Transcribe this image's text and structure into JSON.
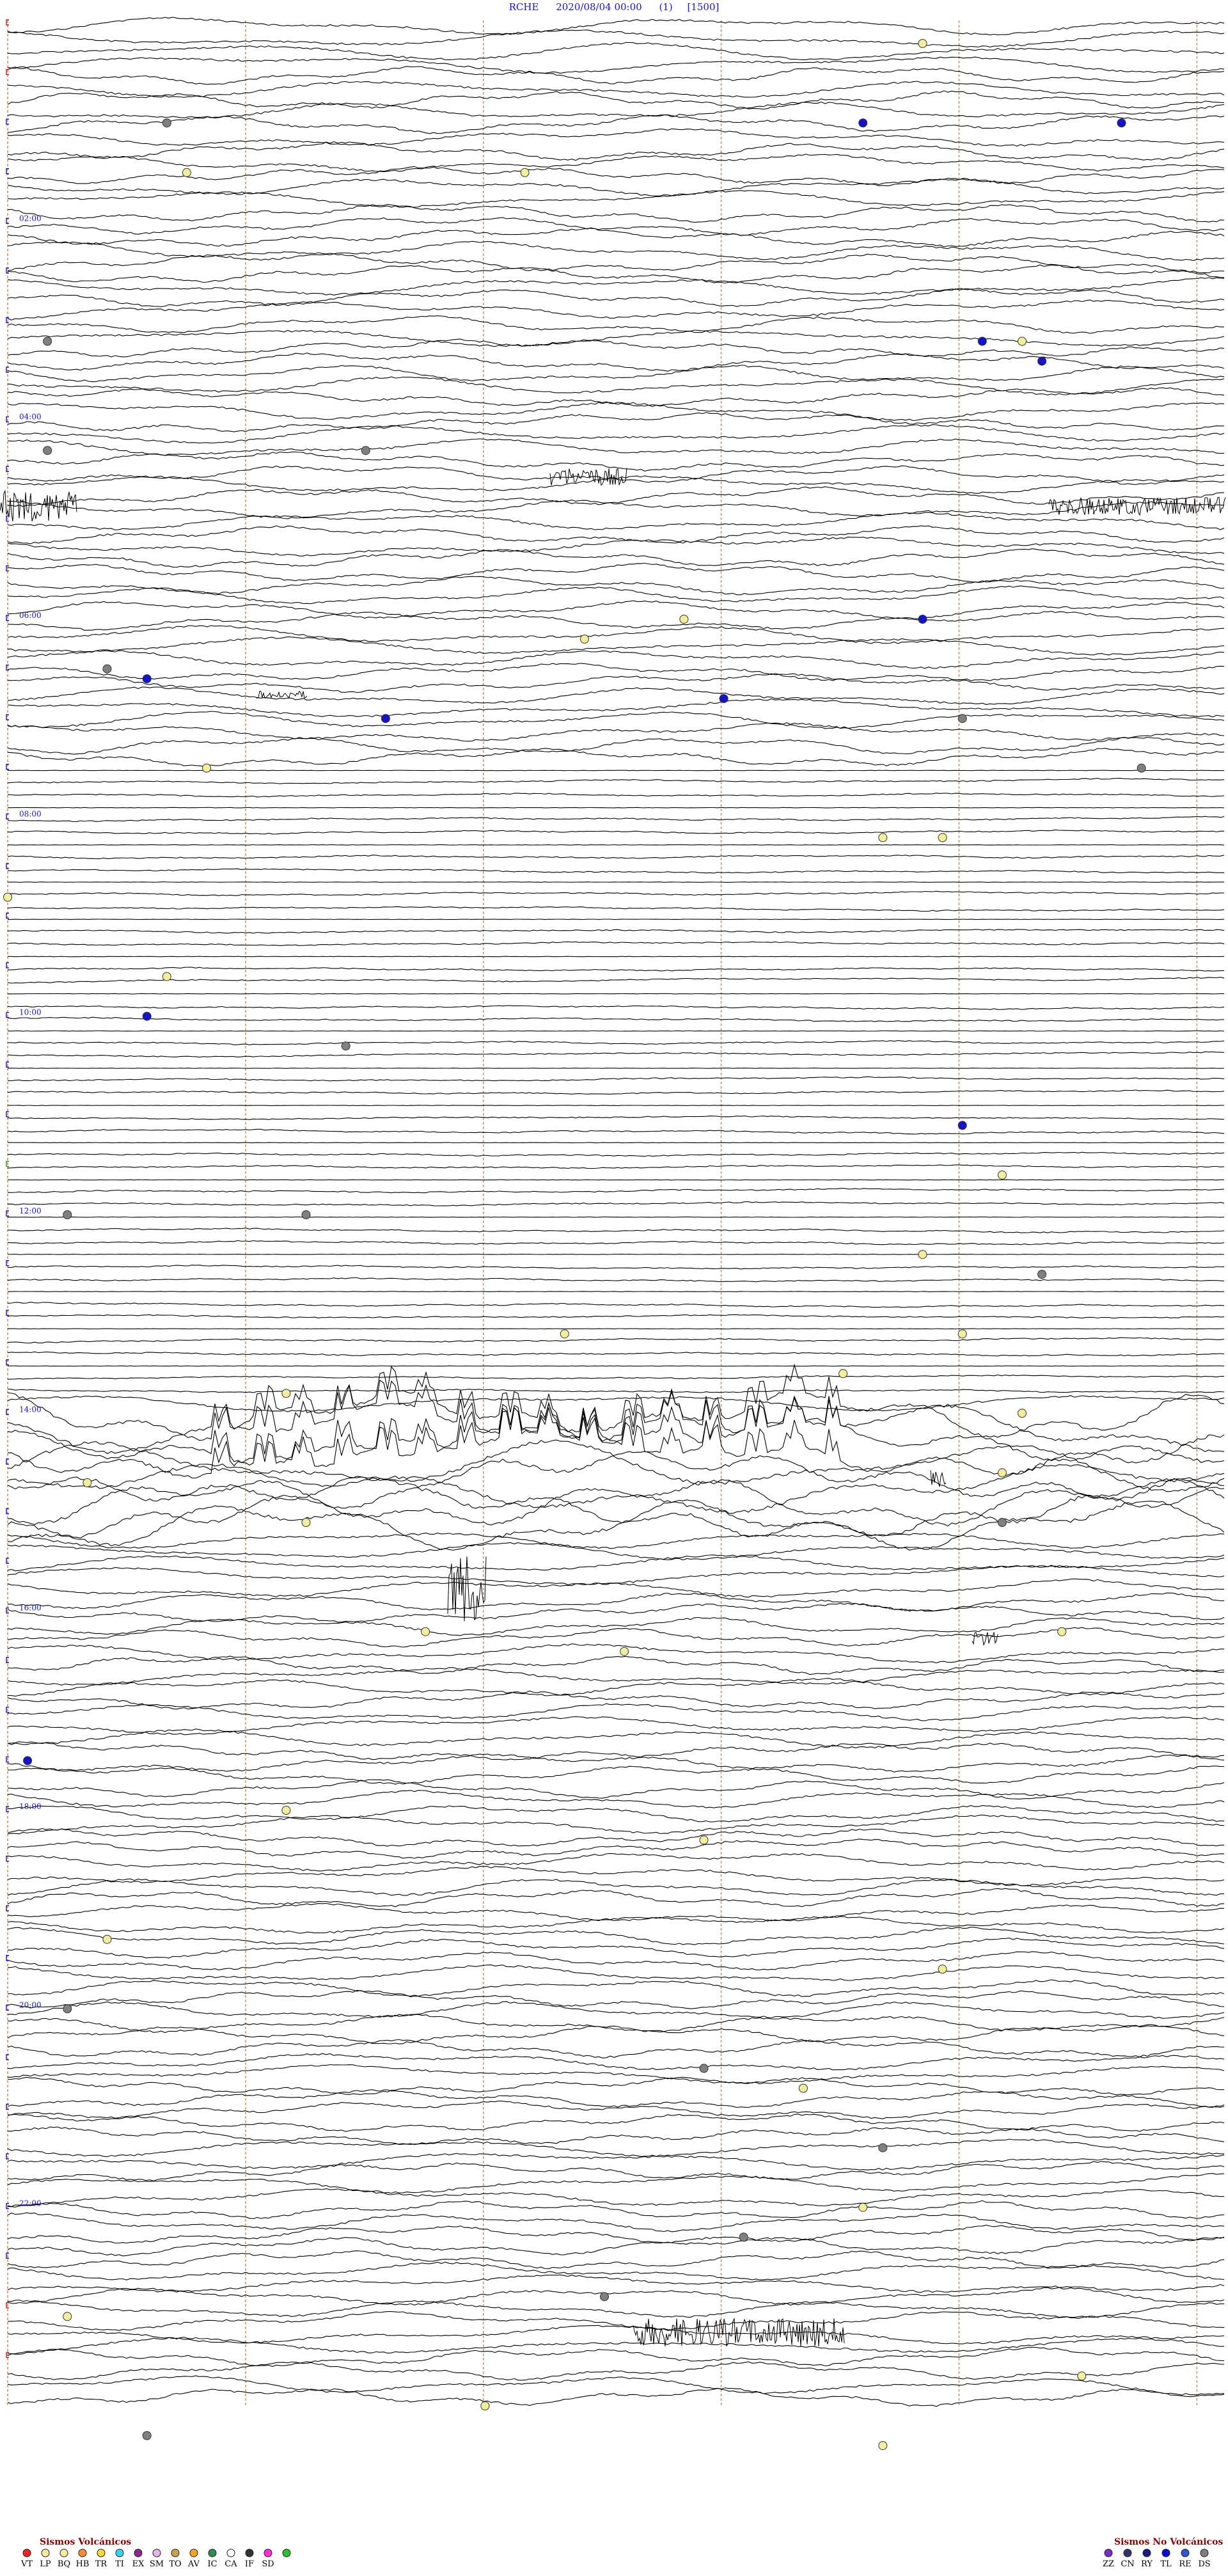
{
  "header": {
    "station": "RCHE",
    "datetime": "2020/08/04 00:00",
    "component": "(1)",
    "scale": "[1500]"
  },
  "chart_data": {
    "type": "line",
    "title": "RCHE    2020/08/04 00:00      (1)     [1500]",
    "description_hint": "helicorder seismogram, 24 hours",
    "time_labels": [
      "02:00",
      "04:00",
      "06:00",
      "08:00",
      "10:00",
      "12:00",
      "14:00",
      "16:00",
      "18:00",
      "20:00",
      "22:00"
    ],
    "hours": 24,
    "grid": true,
    "colors": {
      "trace": "#000000",
      "time_label": "#1414c8",
      "minute_guides": "#e07a3c",
      "row_marker_blue": "#1414c8",
      "row_marker_red": "#c81414",
      "row_marker_green": "#14a014"
    },
    "event_markers": [
      {
        "hour": 0.2,
        "minute": 46,
        "type": "LP"
      },
      {
        "hour": 1.0,
        "minute": 8,
        "type": "DS"
      },
      {
        "hour": 1.0,
        "minute": 56,
        "type": "RE"
      },
      {
        "hour": 1.0,
        "minute": 43,
        "type": "RE"
      },
      {
        "hour": 1.5,
        "minute": 9,
        "type": "LP"
      },
      {
        "hour": 1.5,
        "minute": 26,
        "type": "LP"
      },
      {
        "hour": 3.2,
        "minute": 51,
        "type": "LP"
      },
      {
        "hour": 3.2,
        "minute": 2,
        "type": "DS"
      },
      {
        "hour": 3.2,
        "minute": 49,
        "type": "RE"
      },
      {
        "hour": 3.4,
        "minute": 52,
        "type": "RE"
      },
      {
        "hour": 4.3,
        "minute": 2,
        "type": "DS"
      },
      {
        "hour": 4.3,
        "minute": 18,
        "type": "DS"
      },
      {
        "hour": 6.0,
        "minute": 34,
        "type": "LP"
      },
      {
        "hour": 6.0,
        "minute": 46,
        "type": "RE"
      },
      {
        "hour": 6.2,
        "minute": 29,
        "type": "LP"
      },
      {
        "hour": 6.5,
        "minute": 5,
        "type": "DS"
      },
      {
        "hour": 6.6,
        "minute": 7,
        "type": "RE"
      },
      {
        "hour": 6.8,
        "minute": 36,
        "type": "RE"
      },
      {
        "hour": 7.0,
        "minute": 19,
        "type": "RE"
      },
      {
        "hour": 7.0,
        "minute": 48,
        "type": "DS"
      },
      {
        "hour": 7.5,
        "minute": 10,
        "type": "LP"
      },
      {
        "hour": 7.5,
        "minute": 57,
        "type": "DS"
      },
      {
        "hour": 8.2,
        "minute": 44,
        "type": "LP"
      },
      {
        "hour": 8.2,
        "minute": 47,
        "type": "LP"
      },
      {
        "hour": 8.8,
        "minute": 0,
        "type": "LP"
      },
      {
        "hour": 9.6,
        "minute": 8,
        "type": "LP"
      },
      {
        "hour": 10.0,
        "minute": 7,
        "type": "RE"
      },
      {
        "hour": 10.3,
        "minute": 17,
        "type": "DS"
      },
      {
        "hour": 11.1,
        "minute": 48,
        "type": "RE"
      },
      {
        "hour": 11.6,
        "minute": 50,
        "type": "LP"
      },
      {
        "hour": 12.0,
        "minute": 3,
        "type": "DS"
      },
      {
        "hour": 12.0,
        "minute": 15,
        "type": "DS"
      },
      {
        "hour": 12.4,
        "minute": 46,
        "type": "LP"
      },
      {
        "hour": 12.6,
        "minute": 52,
        "type": "DS"
      },
      {
        "hour": 13.2,
        "minute": 28,
        "type": "LP"
      },
      {
        "hour": 13.2,
        "minute": 48,
        "type": "LP"
      },
      {
        "hour": 13.6,
        "minute": 42,
        "type": "LP"
      },
      {
        "hour": 13.8,
        "minute": 14,
        "type": "LP"
      },
      {
        "hour": 14.0,
        "minute": 51,
        "type": "LP"
      },
      {
        "hour": 14.6,
        "minute": 50,
        "type": "LP"
      },
      {
        "hour": 14.7,
        "minute": 4,
        "type": "LP"
      },
      {
        "hour": 15.1,
        "minute": 15,
        "type": "LP"
      },
      {
        "hour": 15.1,
        "minute": 50,
        "type": "DS"
      },
      {
        "hour": 16.2,
        "minute": 21,
        "type": "LP"
      },
      {
        "hour": 16.2,
        "minute": 53,
        "type": "LP"
      },
      {
        "hour": 16.4,
        "minute": 31,
        "type": "LP"
      },
      {
        "hour": 17.5,
        "minute": 1,
        "type": "RE"
      },
      {
        "hour": 18.0,
        "minute": 14,
        "type": "LP"
      },
      {
        "hour": 18.3,
        "minute": 35,
        "type": "LP"
      },
      {
        "hour": 19.3,
        "minute": 5,
        "type": "LP"
      },
      {
        "hour": 19.6,
        "minute": 47,
        "type": "LP"
      },
      {
        "hour": 20.0,
        "minute": 3,
        "type": "DS"
      },
      {
        "hour": 20.6,
        "minute": 35,
        "type": "DS"
      },
      {
        "hour": 20.8,
        "minute": 40,
        "type": "LP"
      },
      {
        "hour": 21.4,
        "minute": 44,
        "type": "DS"
      },
      {
        "hour": 22.0,
        "minute": 43,
        "type": "LP"
      },
      {
        "hour": 22.3,
        "minute": 37,
        "type": "DS"
      },
      {
        "hour": 22.9,
        "minute": 30,
        "type": "DS"
      },
      {
        "hour": 23.1,
        "minute": 3,
        "type": "LP"
      },
      {
        "hour": 23.7,
        "minute": 54,
        "type": "LP"
      },
      {
        "hour": 24.0,
        "minute": 24,
        "type": "LP"
      },
      {
        "hour": 24.3,
        "minute": 7,
        "type": "DS"
      },
      {
        "hour": 24.4,
        "minute": 44,
        "type": "LP"
      }
    ]
  },
  "legend": {
    "volcanic_title": "Sismos Volcánicos",
    "volcanic": [
      {
        "label": "VT",
        "color": "#e8262a"
      },
      {
        "label": "LP",
        "color": "#f2ee9c"
      },
      {
        "label": "BQ",
        "color": "#f2ee9c"
      },
      {
        "label": "HB",
        "color": "#f58f3a"
      },
      {
        "label": "TR",
        "color": "#f2da3a"
      },
      {
        "label": "TI",
        "color": "#3ad2f2"
      },
      {
        "label": "EX",
        "color": "#8a2b8a"
      },
      {
        "label": "SM",
        "color": "#e6b3e6"
      },
      {
        "label": "TO",
        "color": "#c8a050"
      },
      {
        "label": "AV",
        "color": "#f5a623"
      },
      {
        "label": "IC",
        "color": "#2e8b57"
      },
      {
        "label": "CA",
        "color": "#ffffff"
      },
      {
        "label": "IF",
        "color": "#333333"
      },
      {
        "label": "SD",
        "color": "#ff2fd0"
      },
      {
        "label": "",
        "color": "#2fbf2f"
      }
    ],
    "non_volcanic_title": "Sismos No Volcánicos",
    "non_volcanic": [
      {
        "label": "ZZ",
        "color": "#7b2fbe"
      },
      {
        "label": "CN",
        "color": "#333366"
      },
      {
        "label": "RY",
        "color": "#1a1a80"
      },
      {
        "label": "TL",
        "color": "#0a0ad2"
      },
      {
        "label": "RE",
        "color": "#3355cc"
      },
      {
        "label": "DS",
        "color": "#808080"
      }
    ]
  }
}
